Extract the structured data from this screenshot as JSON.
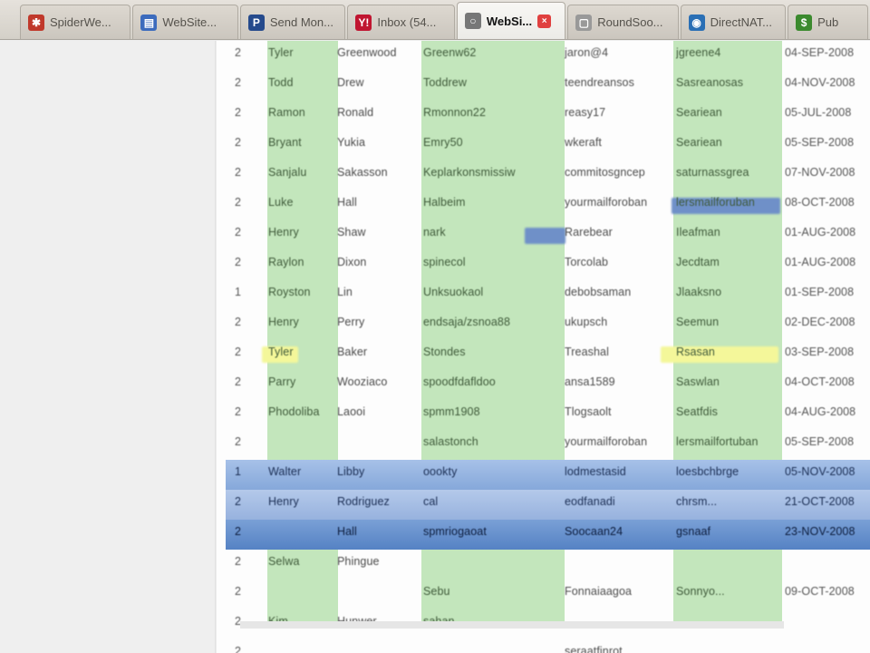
{
  "tabs": [
    {
      "label": "SpiderWe...",
      "icon": "spider-icon",
      "color": "#c0392b",
      "glyph": "✱"
    },
    {
      "label": "WebSite...",
      "icon": "document-icon",
      "color": "#3c6bbd",
      "glyph": "▤"
    },
    {
      "label": "Send Mon...",
      "icon": "paypal-icon",
      "color": "#254a8c",
      "glyph": "P"
    },
    {
      "label": "Inbox (54...",
      "icon": "yahoo-mail-icon",
      "color": "#c01530",
      "glyph": "Y!"
    },
    {
      "label": "WebSi...",
      "icon": "loading-icon",
      "color": "#777777",
      "glyph": "○",
      "active": true
    },
    {
      "label": "RoundSoo...",
      "icon": "page-icon",
      "color": "#999999",
      "glyph": "▢"
    },
    {
      "label": "DirectNAT...",
      "icon": "globe-icon",
      "color": "#2a6fb5",
      "glyph": "◉"
    },
    {
      "label": "Pub",
      "icon": "dollar-icon",
      "color": "#3b8a2e",
      "glyph": "$"
    }
  ],
  "table": {
    "rows": [
      {
        "cells": [
          "2",
          "Tyler",
          "Greenwood",
          "Greenw62",
          "jaron@4",
          "jgreene4",
          "04-SEP-2008"
        ]
      },
      {
        "cells": [
          "2",
          "Todd",
          "Drew",
          "Toddrew",
          "teendreansos",
          "Sasreanosas",
          "04-NOV-2008"
        ]
      },
      {
        "cells": [
          "2",
          "Ramon",
          "Ronald",
          "Rmonnon22",
          "reasy17",
          "Seariean",
          "05-JUL-2008"
        ]
      },
      {
        "cells": [
          "2",
          "Bryant",
          "Yukia",
          "Emry50",
          "wkeraft",
          "Seariean",
          "05-SEP-2008"
        ]
      },
      {
        "cells": [
          "2",
          "Sanjalu",
          "Sakasson",
          "Keplarkonsmissiw",
          "commitosgncep",
          "saturnassgrea",
          "07-NOV-2008"
        ]
      },
      {
        "cells": [
          "2",
          "Luke",
          "Hall",
          "Halbeim",
          "yourmailforoban",
          "lersmailforuban",
          "08-OCT-2008"
        ]
      },
      {
        "cells": [
          "2",
          "Henry",
          "Shaw",
          "nark",
          "Rarebear",
          "Ileafman",
          "01-AUG-2008"
        ]
      },
      {
        "cells": [
          "2",
          "Raylon",
          "Dixon",
          "spinecol",
          "Torcolab",
          "Jecdtam",
          "01-AUG-2008"
        ]
      },
      {
        "cells": [
          "1",
          "Royston",
          "Lin",
          "Unksuokaol",
          "debobsaman",
          "Jlaaksno",
          "01-SEP-2008"
        ]
      },
      {
        "cells": [
          "2",
          "Henry",
          "Perry",
          "endsaja/zsnoa88",
          "ukupsch",
          "Seemun",
          "02-DEC-2008"
        ]
      },
      {
        "cells": [
          "2",
          "Tyler",
          "Baker",
          "Stondes",
          "Treashal",
          "Rsasan",
          "03-SEP-2008"
        ]
      },
      {
        "cells": [
          "2",
          "Parry",
          "Wooziaco",
          "spoodfdafldoo",
          "ansa1589",
          "Saswlan",
          "04-OCT-2008"
        ]
      },
      {
        "cells": [
          "2",
          "Phodoliba",
          "Laooi",
          "spmm1908",
          "Tlogsaolt",
          "Seatfdis",
          "04-AUG-2008"
        ]
      },
      {
        "cells": [
          "2",
          "",
          "",
          "salastonch",
          "yourmailforoban",
          "lersmailfortuban",
          "05-SEP-2008"
        ]
      },
      {
        "cells": [
          "1",
          "Walter",
          "Libby",
          "oookty",
          "lodmestasid",
          "loesbchbrge",
          "05-NOV-2008"
        ]
      },
      {
        "cells": [
          "2",
          "Henry",
          "Rodriguez",
          "cal",
          "eodfanadi",
          "chrsm...",
          "21-OCT-2008"
        ]
      },
      {
        "cells": [
          "2",
          "",
          "Hall",
          "spmriogaoat",
          "Soocaan24",
          "gsnaaf",
          "23-NOV-2008"
        ]
      },
      {
        "cells": [
          "2",
          "Selwa",
          "Phingue",
          "",
          "",
          "",
          ""
        ]
      },
      {
        "cells": [
          "2",
          "",
          "",
          "Sebu",
          "Fonnaiaagoa",
          "Sonnyo...",
          "09-OCT-2008"
        ]
      },
      {
        "cells": [
          "2",
          "Kim",
          "Hunwer",
          "sahan",
          "",
          "",
          ""
        ]
      },
      {
        "cells": [
          "2",
          "",
          "",
          "",
          "seraatfinrot",
          "",
          ""
        ]
      }
    ]
  }
}
